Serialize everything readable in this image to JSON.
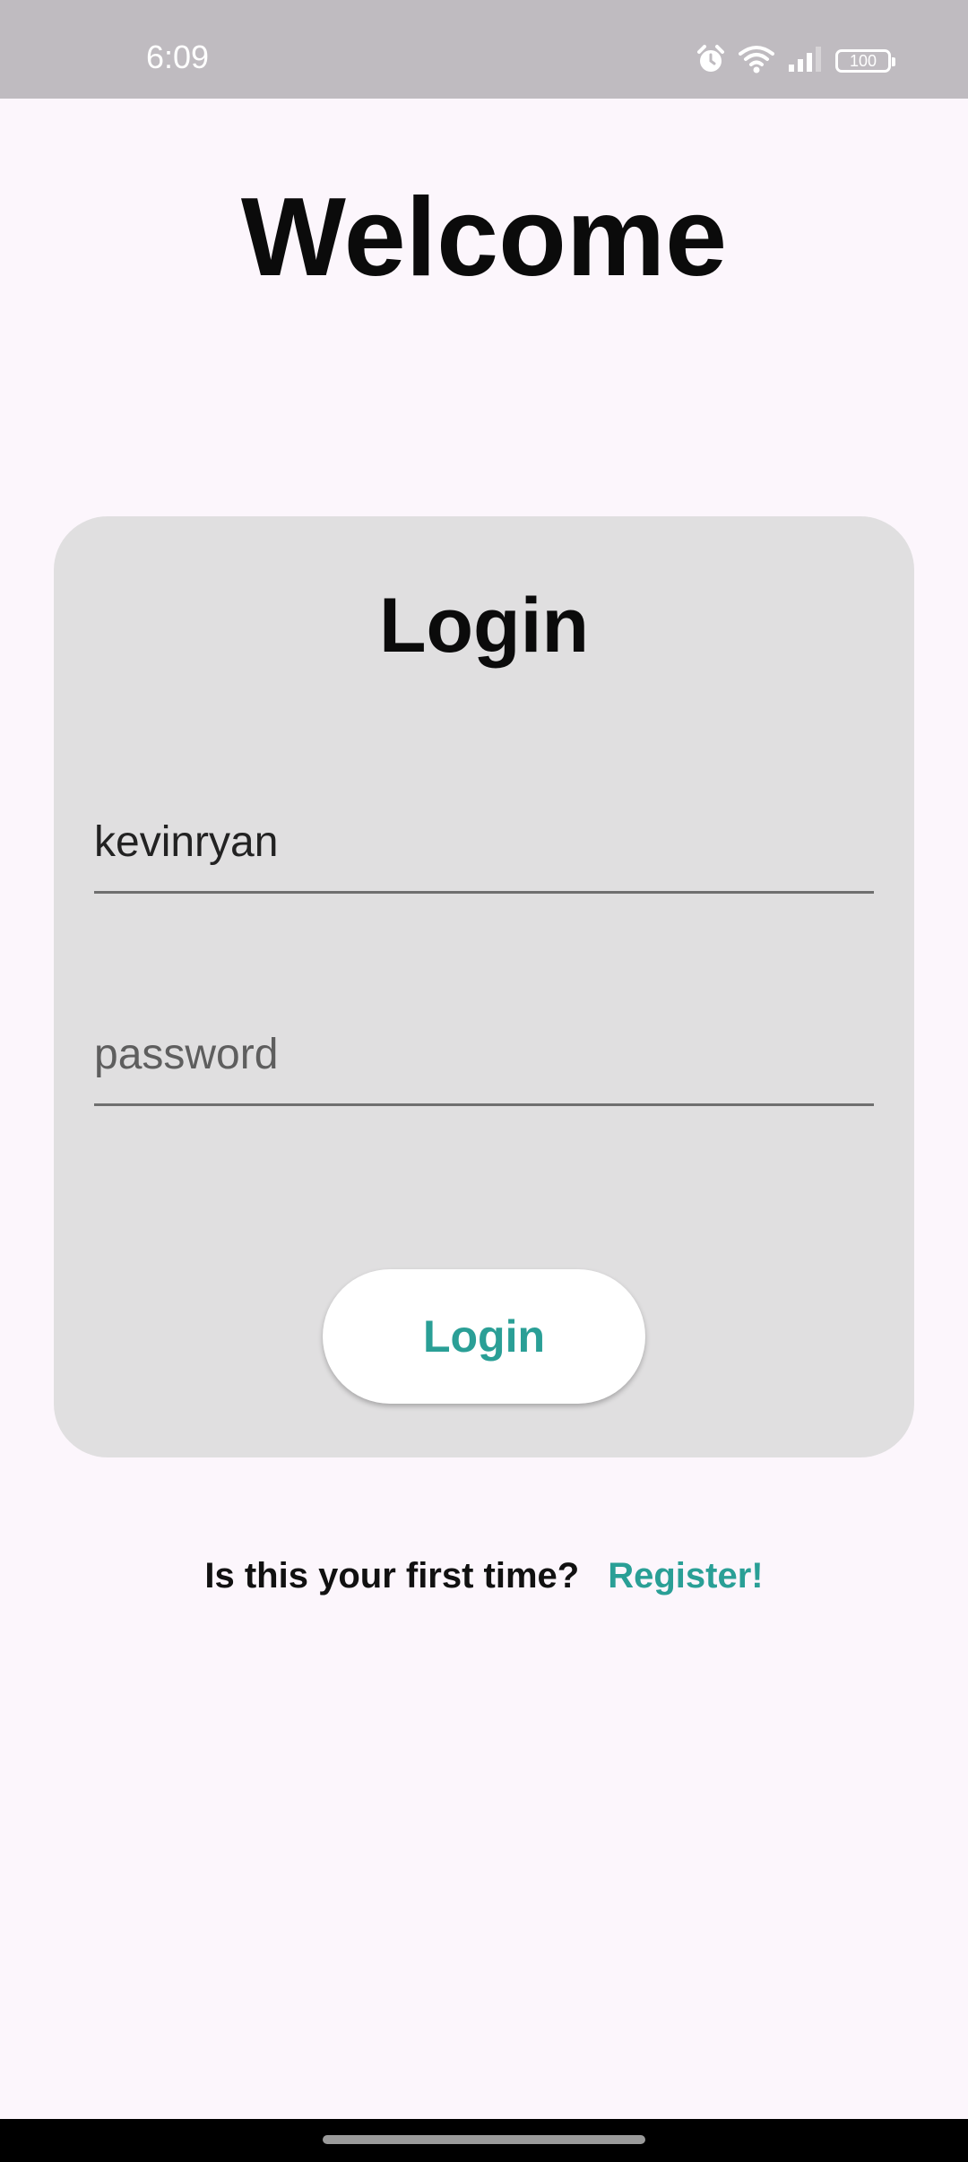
{
  "status_bar": {
    "time": "6:09",
    "battery_level": "100",
    "icons": [
      "alarm-icon",
      "wifi-icon",
      "signal-icon",
      "battery-icon"
    ]
  },
  "header": {
    "title": "Welcome"
  },
  "login_card": {
    "title": "Login",
    "username_value": "kevinryan",
    "password_placeholder": "password",
    "button_label": "Login"
  },
  "register": {
    "question": "Is this your first time?",
    "link_label": "Register!"
  },
  "colors": {
    "accent": "#2a9f96",
    "background": "#fcf6fc",
    "card": "#e0dfe0",
    "status_bar": "#bfbbc0"
  }
}
